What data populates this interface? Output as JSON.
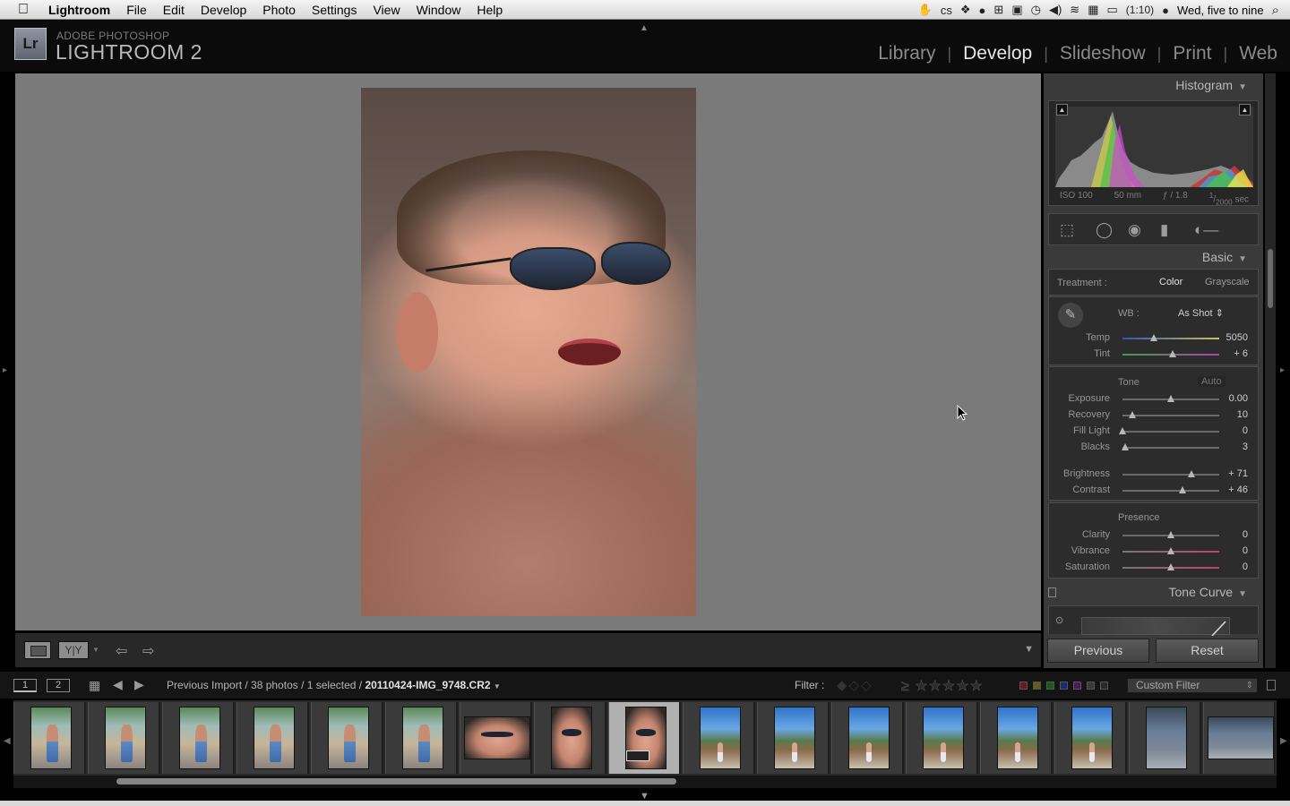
{
  "menubar": {
    "app_name": "Lightroom",
    "menus": [
      "File",
      "Edit",
      "Develop",
      "Photo",
      "Settings",
      "View",
      "Window",
      "Help"
    ],
    "battery": "(1:10)",
    "clock": "Wed, five to nine"
  },
  "header": {
    "brand_top": "ADOBE PHOTOSHOP",
    "brand_main": "LIGHTROOM 2",
    "logo": "Lr",
    "modules": [
      "Library",
      "Develop",
      "Slideshow",
      "Print",
      "Web"
    ],
    "active_module": "Develop"
  },
  "histogram": {
    "title": "Histogram",
    "iso": "ISO 100",
    "focal": "50 mm",
    "aperture": "ƒ / 1.8",
    "shutter_num": "1",
    "shutter_den": "2000",
    "shutter_unit": "sec"
  },
  "basic": {
    "title": "Basic",
    "treatment_label": "Treatment :",
    "treatment_color": "Color",
    "treatment_gray": "Grayscale",
    "wb_label": "WB :",
    "wb_value": "As Shot",
    "tone_label": "Tone",
    "auto_label": "Auto",
    "presence_label": "Presence",
    "sliders": [
      {
        "label": "Temp",
        "value": "5050",
        "pos": 0.32
      },
      {
        "label": "Tint",
        "value": "+ 6",
        "pos": 0.52
      },
      {
        "label": "Exposure",
        "value": "0.00",
        "pos": 0.5
      },
      {
        "label": "Recovery",
        "value": "10",
        "pos": 0.1
      },
      {
        "label": "Fill Light",
        "value": "0",
        "pos": 0.0
      },
      {
        "label": "Blacks",
        "value": "3",
        "pos": 0.03
      },
      {
        "label": "Brightness",
        "value": "+ 71",
        "pos": 0.71
      },
      {
        "label": "Contrast",
        "value": "+ 46",
        "pos": 0.62
      },
      {
        "label": "Clarity",
        "value": "0",
        "pos": 0.5
      },
      {
        "label": "Vibrance",
        "value": "0",
        "pos": 0.5
      },
      {
        "label": "Saturation",
        "value": "0",
        "pos": 0.5
      }
    ]
  },
  "tone_curve": {
    "title": "Tone Curve"
  },
  "panel_buttons": {
    "previous": "Previous",
    "reset": "Reset"
  },
  "filmbar": {
    "screen1": "1",
    "screen2": "2",
    "source_prefix": "Previous Import / 38 photos / 1 selected / ",
    "filename": "20110424-IMG_9748.CR2",
    "filter_label": "Filter :",
    "custom_filter": "Custom Filter"
  },
  "filmstrip": {
    "thumbnails": [
      "pool",
      "pool",
      "pool",
      "pool",
      "pool",
      "pool",
      "face",
      "face",
      "face",
      "hut",
      "hut",
      "hut",
      "hut",
      "hut",
      "hut",
      "group",
      "group"
    ],
    "selected_index": 8
  }
}
